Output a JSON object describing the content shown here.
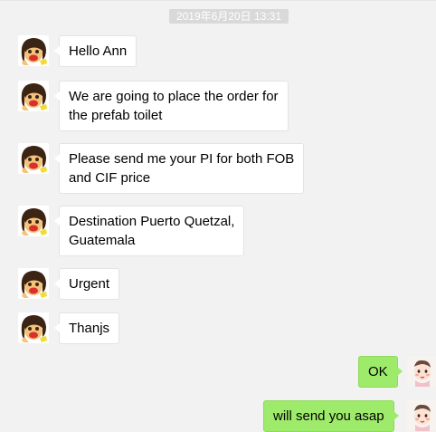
{
  "chat": {
    "timestamp": "2019年6月20日 13:31",
    "messages": [
      {
        "side": "left",
        "text": "Hello Ann"
      },
      {
        "side": "left",
        "text": "We are going to place the order for\nthe prefab toilet"
      },
      {
        "side": "left",
        "text": "Please send me your PI for both FOB\nand CIF price"
      },
      {
        "side": "left",
        "text": "Destination Puerto Quetzal,\nGuatemala"
      },
      {
        "side": "left",
        "text": "Urgent"
      },
      {
        "side": "left",
        "text": "Thanjs"
      },
      {
        "side": "right",
        "text": "OK"
      },
      {
        "side": "right",
        "text": "will send you asap"
      }
    ]
  },
  "colors": {
    "background": "#f2f2f2",
    "incoming_bubble": "#ffffff",
    "outgoing_bubble": "#9eea6a",
    "timestamp_badge": "#d9d9d9"
  },
  "avatars": {
    "contact": "cartoon-girl-avatar",
    "self": "cartoon-baby-avatar"
  }
}
